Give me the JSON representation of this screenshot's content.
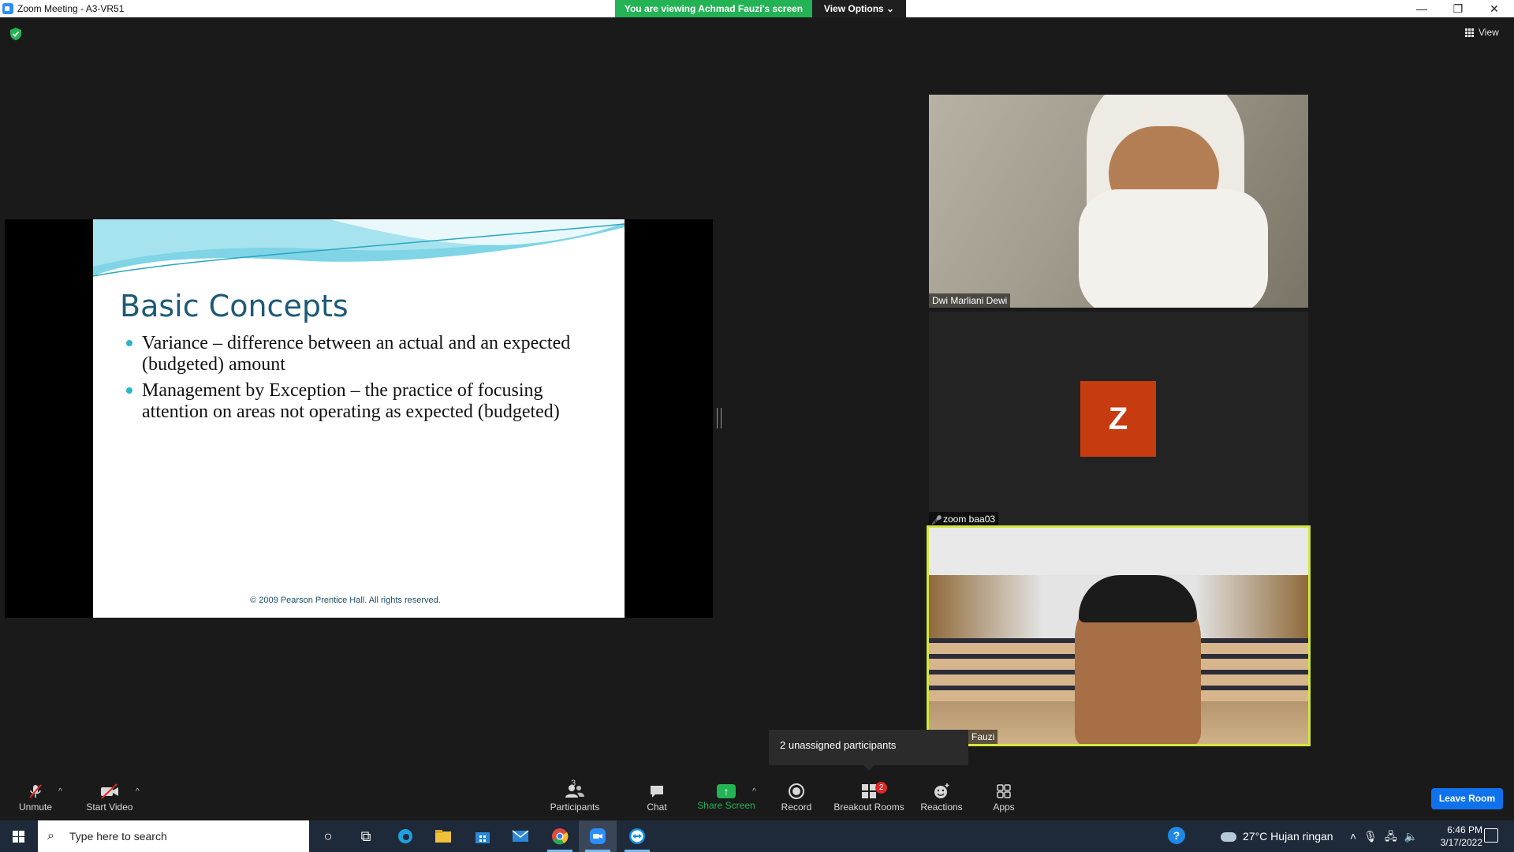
{
  "window": {
    "title": "Zoom Meeting - A3-VR51",
    "banner_text": "You are viewing Achmad Fauzi's screen",
    "view_options_label": "View Options ⌄"
  },
  "top": {
    "view_label": "View"
  },
  "slide": {
    "title": "Basic Concepts",
    "bullets": [
      "Variance – difference between an actual and an expected (budgeted) amount",
      "Management by Exception – the practice of focusing attention on areas not operating as expected (budgeted)"
    ],
    "footer": "© 2009 Pearson Prentice Hall. All rights reserved."
  },
  "participants": {
    "tile1_name": "Dwi Marliani Dewi",
    "tile2_name": "zoom baa03",
    "tile2_avatar": "Z",
    "tile3_name": "Fauzi"
  },
  "tooltip": {
    "text": "2 unassigned participants"
  },
  "toolbar": {
    "unmute": "Unmute",
    "start_video": "Start Video",
    "participants": "Participants",
    "participants_count": "3",
    "chat": "Chat",
    "share_screen": "Share Screen",
    "record": "Record",
    "breakout_rooms": "Breakout Rooms",
    "breakout_count": "2",
    "reactions": "Reactions",
    "apps": "Apps",
    "leave": "Leave Room"
  },
  "taskbar": {
    "search_placeholder": "Type here to search",
    "weather": "27°C  Hujan ringan",
    "time": "6:46 PM",
    "date": "3/17/2022"
  },
  "colors": {
    "share_green": "#23b354",
    "leave_blue": "#0e72ed",
    "avatar_orange": "#c73b10",
    "active_speaker": "#d3e640"
  }
}
